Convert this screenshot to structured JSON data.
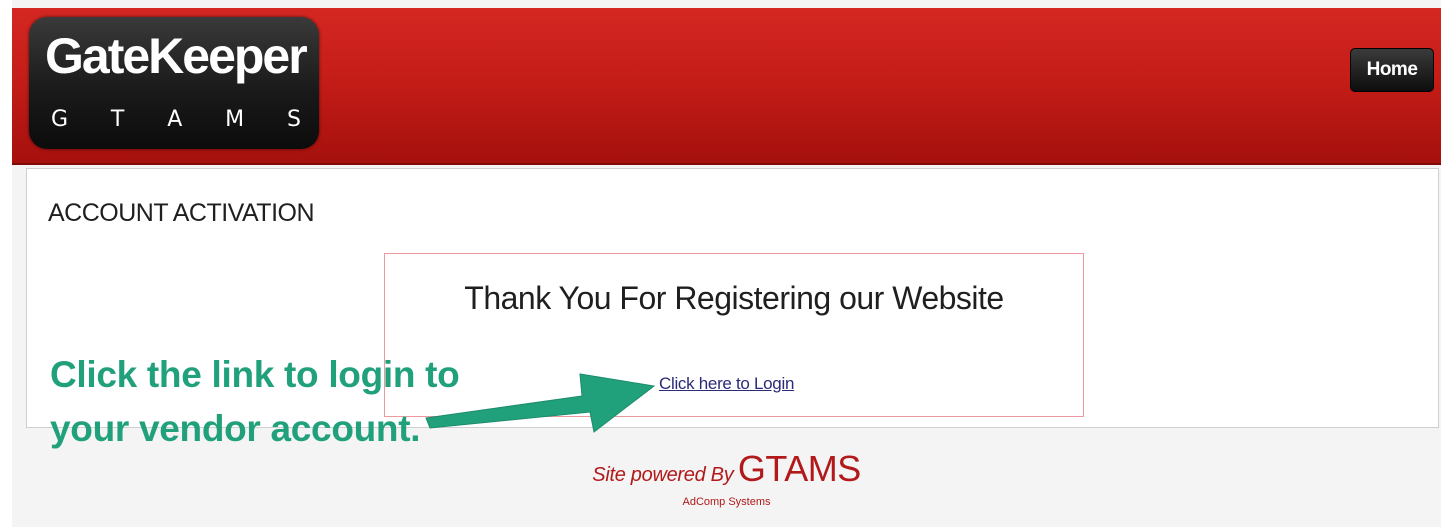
{
  "header": {
    "logo_title": "GateKeeper",
    "logo_subtitle_letters": [
      "G",
      "T",
      "A",
      "M",
      "S"
    ],
    "home_label": "Home"
  },
  "main": {
    "section_title": "ACCOUNT ACTIVATION",
    "thanks_title": "Thank You For Registering our Website",
    "login_link": "Click here to Login"
  },
  "annotation": {
    "line1": "Click the link to login to",
    "line2": "your vendor account."
  },
  "footer": {
    "powered_by": "Site powered By",
    "brand": "GTAMS",
    "company": "AdComp Systems"
  },
  "colors": {
    "header_red": "#c51d18",
    "annotation_green": "#21a07c",
    "footer_red": "#b1191a"
  }
}
